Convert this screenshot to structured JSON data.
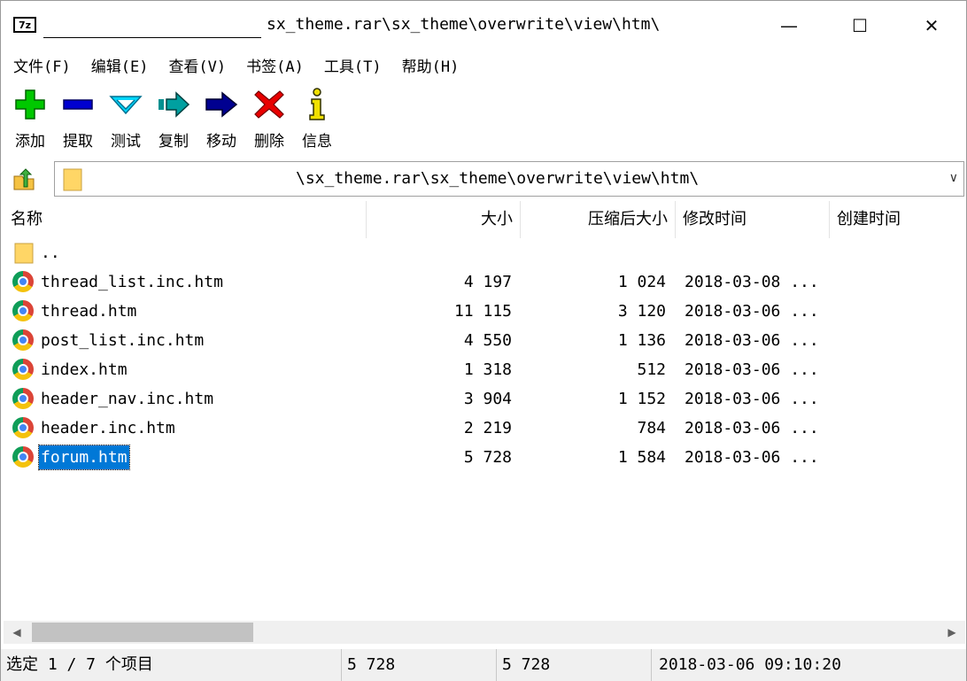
{
  "window": {
    "title": "sx_theme.rar\\sx_theme\\overwrite\\view\\htm\\",
    "minimize_symbol": "—",
    "maximize_symbol": "☐",
    "close_symbol": "✕"
  },
  "menu": {
    "items": [
      {
        "label": "文件(F)"
      },
      {
        "label": "编辑(E)"
      },
      {
        "label": "查看(V)"
      },
      {
        "label": "书签(A)"
      },
      {
        "label": "工具(T)"
      },
      {
        "label": "帮助(H)"
      }
    ]
  },
  "toolbar": {
    "buttons": [
      {
        "label": "添加",
        "icon": "add-icon",
        "color": "#00c000"
      },
      {
        "label": "提取",
        "icon": "extract-icon",
        "color": "#0000c0"
      },
      {
        "label": "测试",
        "icon": "test-icon",
        "color": "#00c0e0"
      },
      {
        "label": "复制",
        "icon": "copy-icon",
        "color": "#008080"
      },
      {
        "label": "移动",
        "icon": "move-icon",
        "color": "#000080"
      },
      {
        "label": "删除",
        "icon": "delete-icon",
        "color": "#e00000"
      },
      {
        "label": "信息",
        "icon": "info-icon",
        "color": "#e0d000"
      }
    ]
  },
  "address": {
    "path": "\\sx_theme.rar\\sx_theme\\overwrite\\view\\htm\\",
    "dropdown_symbol": "∨"
  },
  "columns": {
    "name": "名称",
    "size": "大小",
    "packed": "压缩后大小",
    "modified": "修改时间",
    "created": "创建时间"
  },
  "files": [
    {
      "name": "..",
      "icon": "folder-icon",
      "size": "",
      "packed": "",
      "modified": ""
    },
    {
      "name": "thread_list.inc.htm",
      "icon": "chrome-icon",
      "size": "4 197",
      "packed": "1 024",
      "modified": "2018-03-08 ..."
    },
    {
      "name": "thread.htm",
      "icon": "chrome-icon",
      "size": "11 115",
      "packed": "3 120",
      "modified": "2018-03-06 ..."
    },
    {
      "name": "post_list.inc.htm",
      "icon": "chrome-icon",
      "size": "4 550",
      "packed": "1 136",
      "modified": "2018-03-06 ..."
    },
    {
      "name": "index.htm",
      "icon": "chrome-icon",
      "size": "1 318",
      "packed": "512",
      "modified": "2018-03-06 ..."
    },
    {
      "name": "header_nav.inc.htm",
      "icon": "chrome-icon",
      "size": "3 904",
      "packed": "1 152",
      "modified": "2018-03-06 ..."
    },
    {
      "name": "header.inc.htm",
      "icon": "chrome-icon",
      "size": "2 219",
      "packed": "784",
      "modified": "2018-03-06 ..."
    },
    {
      "name": "forum.htm",
      "icon": "chrome-icon",
      "size": "5 728",
      "packed": "1 584",
      "modified": "2018-03-06 ...",
      "selected": true
    }
  ],
  "scrollbar": {
    "left_symbol": "◀",
    "right_symbol": "▶"
  },
  "status": {
    "selection": "选定 1 / 7 个项目",
    "size": "5 728",
    "packed": "5 728",
    "modified": "2018-03-06 09:10:20"
  }
}
